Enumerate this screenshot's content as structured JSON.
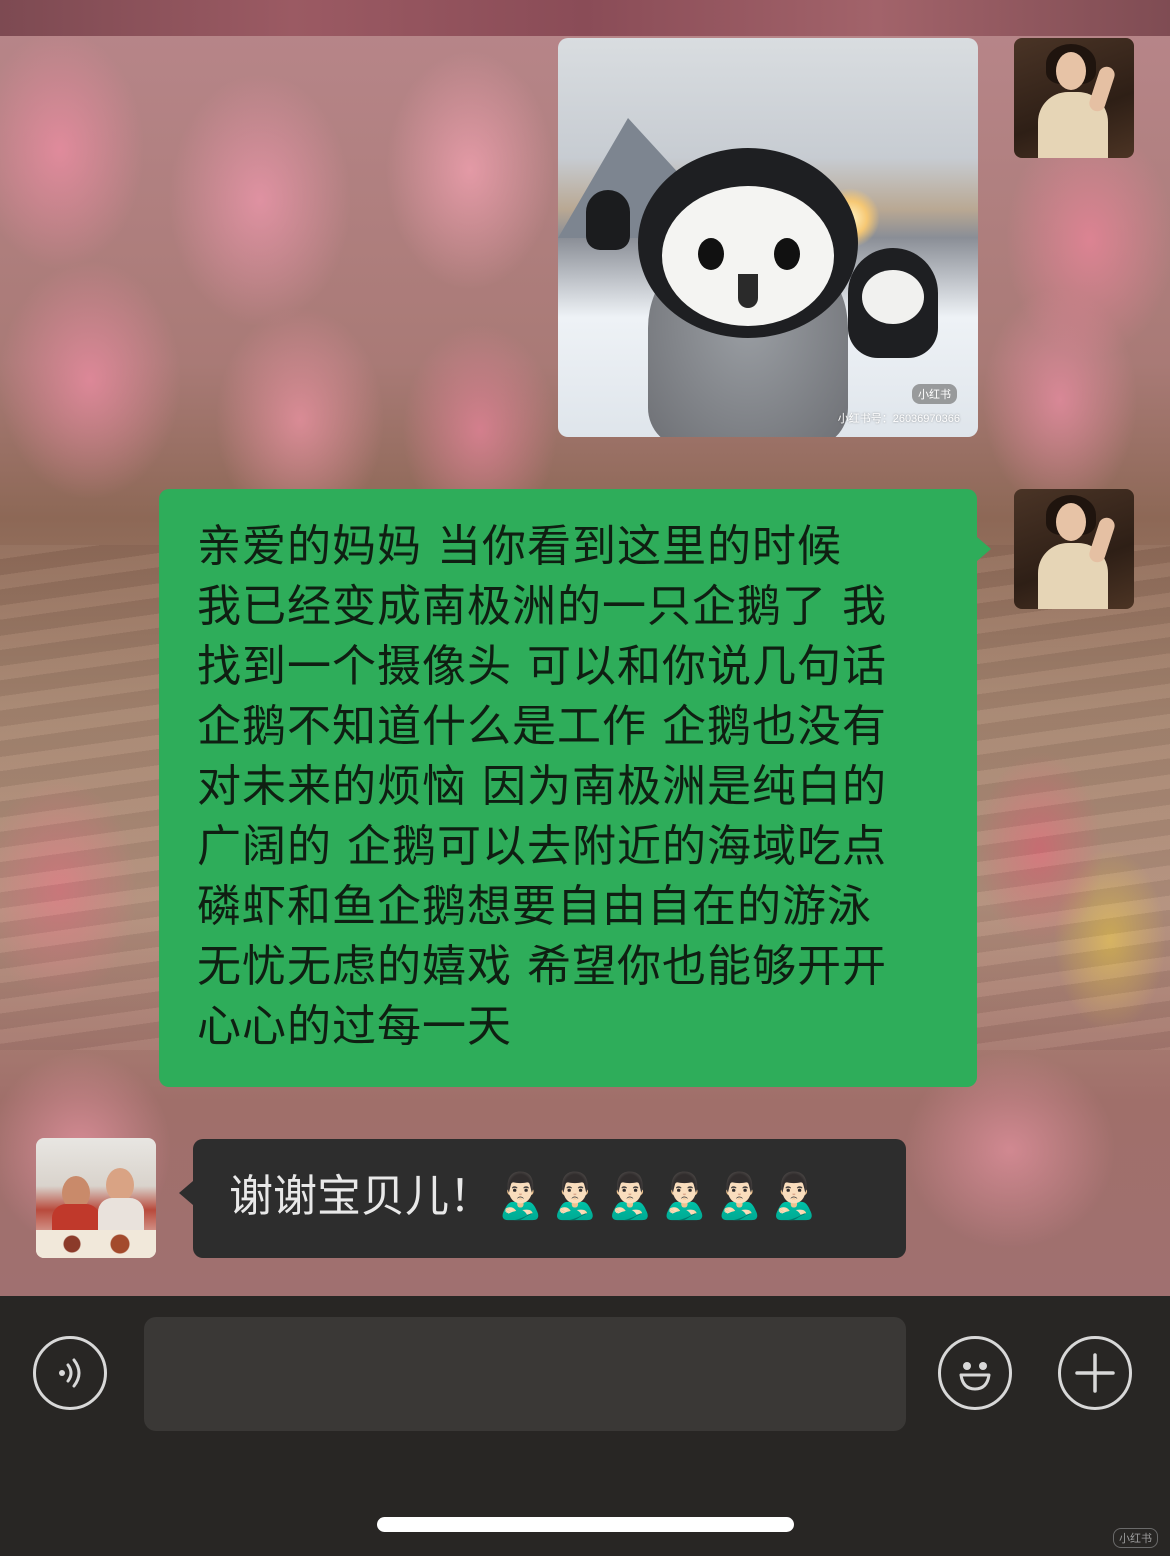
{
  "conversation": {
    "image_message": {
      "image_desc": "baby-penguin-photo",
      "watermark_badge": "小红书",
      "watermark_id": "小红书号：26036970366"
    },
    "sent_message": {
      "lines": [
        "亲爱的妈妈 当你看到这里的时候",
        "我已经变成南极洲的一只企鹅了 我",
        "找到一个摄像头 可以和你说几句话",
        "企鹅不知道什么是工作 企鹅也没有",
        "对未来的烦恼 因为南极洲是纯白的",
        "广阔的 企鹅可以去附近的海域吃点",
        "磷虾和鱼企鹅想要自由自在的游泳",
        "无忧无虑的嬉戏 希望你也能够开开",
        "心心的过每一天"
      ]
    },
    "received_message": {
      "text": "谢谢宝贝儿！🙎🏻‍♂️🙎🏻‍♂️🙎🏻‍♂️🙎🏻‍♂️🙎🏻‍♂️🙎🏻‍♂️"
    }
  },
  "input_bar": {
    "voice_icon": "voice-icon",
    "emoji_icon": "emoji-icon",
    "plus_icon": "plus-icon"
  },
  "corner_watermark": "小红书",
  "colors": {
    "sent_bubble": "#2ead5a",
    "received_bubble": "#2d2d2d",
    "input_bar": "#282624"
  }
}
